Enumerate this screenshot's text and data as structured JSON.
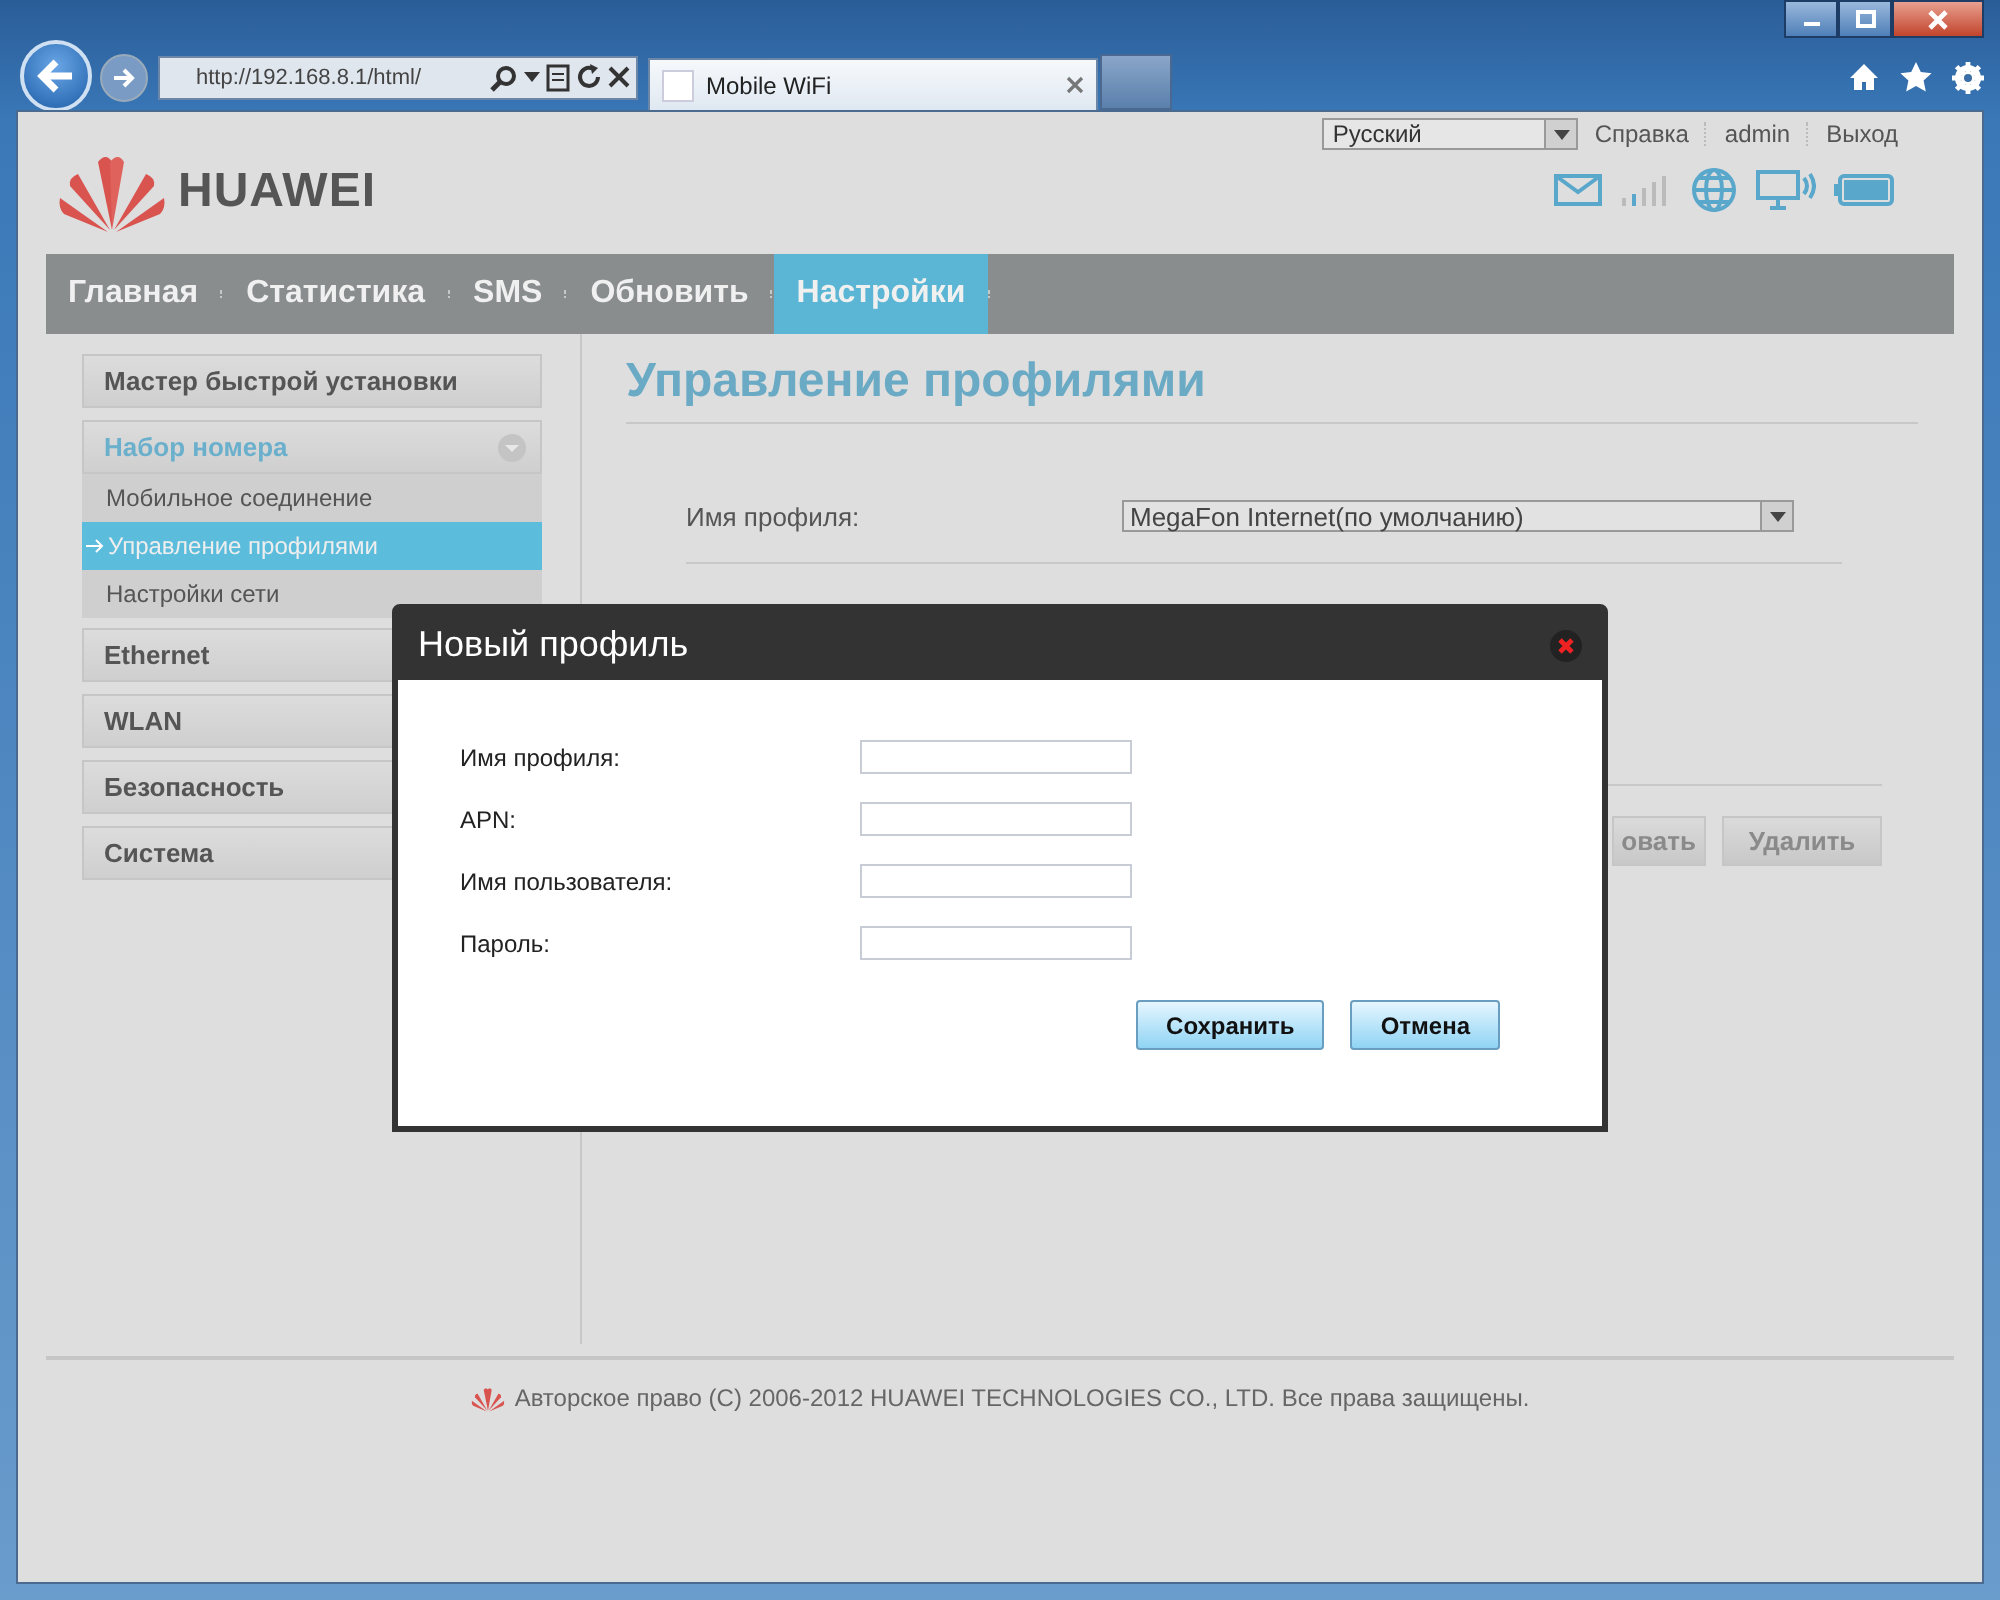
{
  "browser": {
    "address": "http://192.168.8.1/html/",
    "tab_title": "Mobile WiFi"
  },
  "header": {
    "language": "Русский",
    "links": [
      "Справка",
      "admin",
      "Выход"
    ],
    "logo_text": "HUAWEI"
  },
  "nav": [
    {
      "label": "Главная",
      "selected": false
    },
    {
      "label": "Статистика",
      "selected": false
    },
    {
      "label": "SMS",
      "selected": false
    },
    {
      "label": "Обновить",
      "selected": false
    },
    {
      "label": "Настройки",
      "selected": true
    }
  ],
  "sidebar": [
    {
      "label": "Мастер быстрой установки",
      "expanded": false
    },
    {
      "label": "Набор номера",
      "expanded": true,
      "children": [
        {
          "label": "Мобильное соединение",
          "selected": false
        },
        {
          "label": "Управление профилями",
          "selected": true
        },
        {
          "label": "Настройки сети",
          "selected": false
        }
      ]
    },
    {
      "label": "Ethernet",
      "expanded": false
    },
    {
      "label": "WLAN",
      "expanded": false
    },
    {
      "label": "Безопасность",
      "expanded": false
    },
    {
      "label": "Система",
      "expanded": false
    }
  ],
  "content": {
    "title": "Управление профилями",
    "profile_label": "Имя профиля:",
    "profile_value": "MegaFon Internet(по умолчанию)",
    "buttons": [
      "овать",
      "Удалить"
    ]
  },
  "dialog": {
    "title": "Новый профиль",
    "fields": [
      {
        "label": "Имя профиля:"
      },
      {
        "label": "APN:"
      },
      {
        "label": "Имя пользователя:"
      },
      {
        "label": "Пароль:"
      }
    ],
    "buttons": [
      "Сохранить",
      "Отмена"
    ]
  },
  "footer": {
    "copyright": "Авторское право (C) 2006-2012 HUAWEI TECHNOLOGIES CO., LTD. Все права защищены."
  }
}
